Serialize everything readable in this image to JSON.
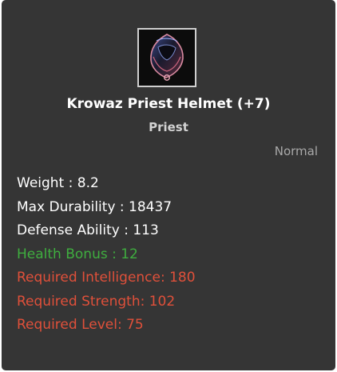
{
  "item": {
    "icon": "priest-helmet-icon",
    "name": "Krowaz Priest Helmet (+7)",
    "class": "Priest",
    "grade": "Normal"
  },
  "stats": [
    {
      "text": "Weight : 8.2",
      "color": "#ffffff"
    },
    {
      "text": "Max Durability : 18437",
      "color": "#ffffff"
    },
    {
      "text": "Defense Ability : 113",
      "color": "#ffffff"
    },
    {
      "text": "Health Bonus : 12",
      "color": "#3fae3f"
    },
    {
      "text": "Required Intelligence: 180",
      "color": "#e0503a"
    },
    {
      "text": "Required Strength: 102",
      "color": "#e0503a"
    },
    {
      "text": "Required Level: 75",
      "color": "#e0503a"
    }
  ]
}
